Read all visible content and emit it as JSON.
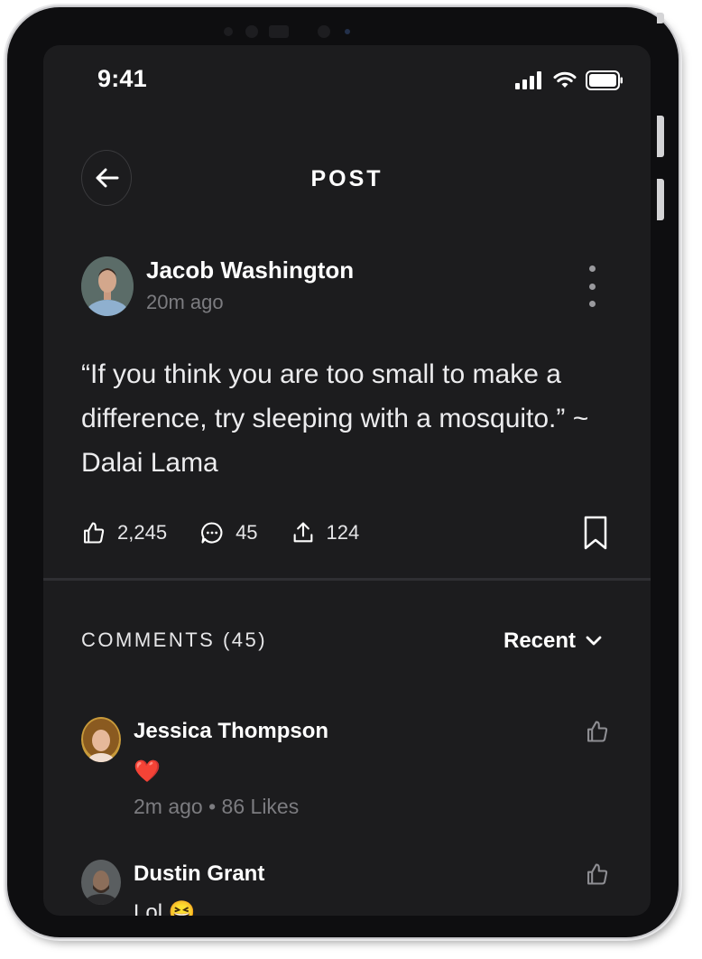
{
  "status_bar": {
    "time": "9:41"
  },
  "header": {
    "title": "POST"
  },
  "post": {
    "author": "Jacob Washington",
    "time": "20m ago",
    "text": "“If you think you are too small to make a difference, try sleeping with a mosquito.” ~ Dalai Lama",
    "likes": "2,245",
    "comments": "45",
    "shares": "124"
  },
  "comments_section": {
    "title": "COMMENTS (45)",
    "sort_label": "Recent"
  },
  "comments": [
    {
      "name": "Jessica Thompson",
      "text": "❤️",
      "meta": "2m ago • 86 Likes"
    },
    {
      "name": "Dustin Grant",
      "text": "Lol 😆"
    }
  ],
  "colors": {
    "screen_bg": "#1c1c1e",
    "text_primary": "#ffffff",
    "text_secondary": "#7c7c80",
    "heart": "#e0202e"
  },
  "icons": [
    "signal-icon",
    "wifi-icon",
    "battery-icon",
    "back-arrow-icon",
    "more-vertical-icon",
    "thumbs-up-icon",
    "comment-icon",
    "share-icon",
    "bookmark-icon",
    "chevron-down-icon"
  ]
}
